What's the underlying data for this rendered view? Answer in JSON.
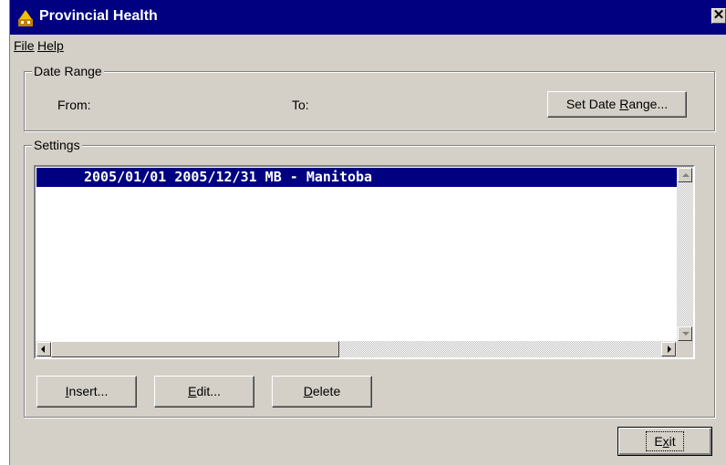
{
  "window": {
    "title": "Provincial Health",
    "close_label": "✕"
  },
  "menu": {
    "file": "File",
    "help": "Help"
  },
  "date_range": {
    "group_label": "Date Range",
    "from_label": "From:",
    "to_label": "To:",
    "set_button": {
      "pre": "Set Date ",
      "u": "R",
      "post": "ange..."
    }
  },
  "settings": {
    "group_label": "Settings",
    "rows": [
      "2005/01/01 2005/12/31 MB - Manitoba"
    ]
  },
  "buttons": {
    "insert": {
      "u": "I",
      "post": "nsert..."
    },
    "edit": {
      "u": "E",
      "post": "dit..."
    },
    "delete": {
      "u": "D",
      "post": "elete"
    },
    "exit": {
      "pre": "E",
      "u": "x",
      "post": "it"
    }
  },
  "colors": {
    "titlebar": "#000080",
    "face": "#d4d0c8",
    "selection": "#000080"
  }
}
